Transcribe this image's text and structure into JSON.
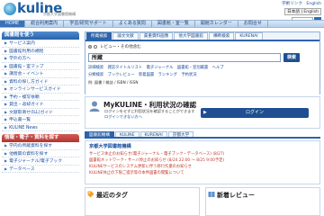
{
  "header": {
    "logo_text": "kuline",
    "logo_sub": "京都大学図書館機構",
    "links": [
      "学術リンク",
      "English"
    ],
    "lang": "日本語 | English"
  },
  "global_nav": [
    "HOME",
    "総合利用案内",
    "学習/研究サポート",
    "よくある質問",
    "図書館・室一覧",
    "開館カレンダー",
    "お問合せ"
  ],
  "sidebar": {
    "section1_title": "図書館を使う",
    "section1_items": [
      "サービス案内",
      "図書館利用の規程",
      "学外の方へ",
      "図書館・室マップ",
      "講習会・イベント",
      "資料の探し方ガイド",
      "オンラインサービスガイド",
      "予約・複写依頼",
      "貸出・返却ガイド",
      "文献取寄せ(ILL)ガイド",
      "申込書一覧",
      "KULINE News"
    ],
    "section2_title": "情報・電子・資料を探す",
    "section2_items": [
      "学内の所蔵資料を探す",
      "他機関の資料を探す",
      "電子ジャーナル/電子ブック",
      "データベース"
    ]
  },
  "search": {
    "tabs": [
      "所蔵検索",
      "論文文献",
      "貴重資料画像",
      "他大学図書館",
      "横断検索",
      "KURENAI"
    ],
    "option_label": "レビュー・その他含む",
    "input_value": "所蔵",
    "button_label": "検索",
    "detail_links": [
      "詳細検索",
      "雑誌タイトルリスト",
      "電子ジャーナル",
      "図書館・室別蔵書",
      "ヘルプ"
    ],
    "filter_links": [
      "分類検索",
      "ブックレビュー",
      "新着図書",
      "ランキング",
      "予約状況"
    ],
    "example": "例: 図書 / 雑誌 / ISBN / ISSN"
  },
  "mykuline": {
    "title": "MyKULINE・利用状況の確認",
    "desc": "ログインをせずに利用状況を確認することができます",
    "link": "ログインできない方へ",
    "login_label": "ログイン"
  },
  "news_tabs": [
    "図書館機構",
    "KULINE",
    "KURENAI",
    "京都大学"
  ],
  "news": {
    "head": "京都大学図書館機構",
    "lines": [
      "サービス休止のお知らせ(電子ジャーナル・電子ブック・データベース) (8/27)",
      "図書館ネットワーク・サーバ停止のお知らせ (8/24 22:00 〜 8/25 9:00予定)",
      "KULINEサービスのシステム更新に伴う移行作業のお知らせ",
      "KULINE休止の下限ご提示等の本件図書の閲覧について"
    ]
  },
  "bottom": {
    "tags_title": "最近のタグ",
    "new_title": "新着レビュー"
  },
  "colors": {
    "primary": "#2d63a8",
    "nav_bg": "#c8dbef",
    "red_section": "#b03631",
    "news_text": "#c0392b"
  }
}
